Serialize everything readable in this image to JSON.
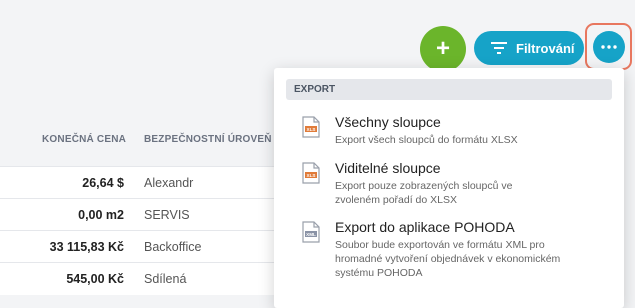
{
  "toolbar": {
    "add_label": "+",
    "filter_label": "Filtrování",
    "more_icon": "more-horizontal-icon"
  },
  "colors": {
    "add": "#6bb52b",
    "primary": "#16a3c8",
    "highlight": "#e8775f",
    "xlsx_icon": "#e07b39",
    "xml_icon": "#8a93a6"
  },
  "table": {
    "headers": {
      "price": "KONEČNÁ CENA",
      "level": "BEZPEČNOSTNÍ ÚROVEŇ"
    },
    "rows": [
      {
        "price": "26,64 $",
        "level": "Alexandr"
      },
      {
        "price": "0,00 m2",
        "level": "SERVIS"
      },
      {
        "price": "33 115,83 Kč",
        "level": "Backoffice"
      },
      {
        "price": "545,00 Kč",
        "level": "Sdílená"
      }
    ]
  },
  "menu": {
    "section": "EXPORT",
    "items": [
      {
        "title": "Všechny sloupce",
        "desc": "Export všech sloupců do formátu XLSX",
        "icon": "xlsx-file-icon",
        "badge": "XLS"
      },
      {
        "title": "Viditelné sloupce",
        "desc": "Export pouze zobrazených sloupců ve zvoleném pořadí do XLSX",
        "icon": "xlsx-file-icon",
        "badge": "XLS"
      },
      {
        "title": "Export do aplikace POHODA",
        "desc": "Soubor bude exportován ve formátu XML pro hromadné vytvoření objednávek v ekonomickém systému POHODA",
        "icon": "xml-file-icon",
        "badge": "XML"
      }
    ]
  }
}
